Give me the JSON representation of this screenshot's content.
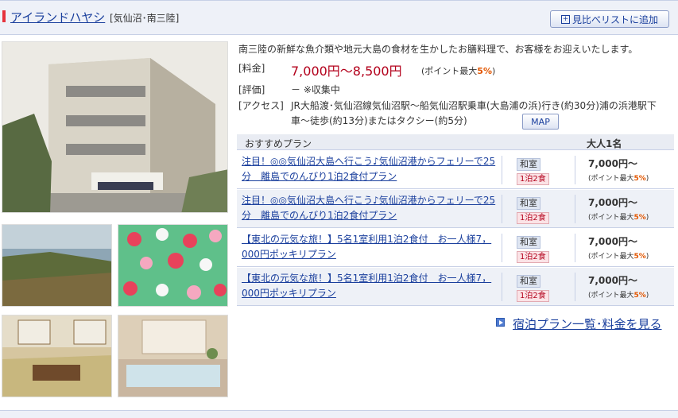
{
  "hotel": {
    "name": "アイランドハヤシ",
    "area": "[気仙沼･南三陸]"
  },
  "compare_button": {
    "icon": "plus-box-icon",
    "label": "見比べリストに追加"
  },
  "description": "南三陸の新鮮な魚介類や地元大島の食材を生かしたお膳料理で、お客様をお迎えいたします。",
  "info": {
    "price_label": "[料金]",
    "price_value": "7,000円〜8,500円",
    "price_point_note": "(ポイント最大",
    "price_point_value": "5%",
    "price_point_close": ")",
    "rating_label": "[評価]",
    "rating_value": "－ ※収集中",
    "access_label": "[アクセス]",
    "access_value": "JR大船渡･気仙沼線気仙沼駅〜船気仙沼駅乗車(大島浦の浜)行き(約30分)浦の浜港駅下車〜徒歩(約13分)またはタクシー(約5分)",
    "map_button": "MAP"
  },
  "plans": {
    "header_left": "おすすめプラン",
    "header_right": "大人1名",
    "rows": [
      {
        "title": "注目！◎◎気仙沼大島へ行こう♪気仙沼港からフェリーで25分　離島でのんびり1泊2食付プラン",
        "room_tag": "和室",
        "meal_tag": "1泊2食",
        "price": "7,000円〜",
        "point_prefix": "(ポイント最大",
        "point_value": "5%",
        "point_suffix": ")"
      },
      {
        "title": "注目！◎◎気仙沼大島へ行こう♪気仙沼港からフェリーで25分　離島でのんびり1泊2食付プラン",
        "room_tag": "和室",
        "meal_tag": "1泊2食",
        "price": "7,000円〜",
        "point_prefix": "(ポイント最大",
        "point_value": "5%",
        "point_suffix": ")"
      },
      {
        "title": "【東北の元気な旅！】5名1室利用1泊2食付　お一人様7，000円ポッキリプラン",
        "room_tag": "和室",
        "meal_tag": "1泊2食",
        "price": "7,000円〜",
        "point_prefix": "(ポイント最大",
        "point_value": "5%",
        "point_suffix": ")"
      },
      {
        "title": "【東北の元気な旅！】5名1室利用1泊2食付　お一人様7，000円ポッキリプラン",
        "room_tag": "和室",
        "meal_tag": "1泊2食",
        "price": "7,000円〜",
        "point_prefix": "(ポイント最大",
        "point_value": "5%",
        "point_suffix": ")"
      }
    ]
  },
  "plan_list_link": "宿泊プラン一覧･料金を見る",
  "colors": {
    "link": "#1a3f9d",
    "price": "#b3001b",
    "accent_bar": "#e6323c",
    "point": "#e25600"
  }
}
